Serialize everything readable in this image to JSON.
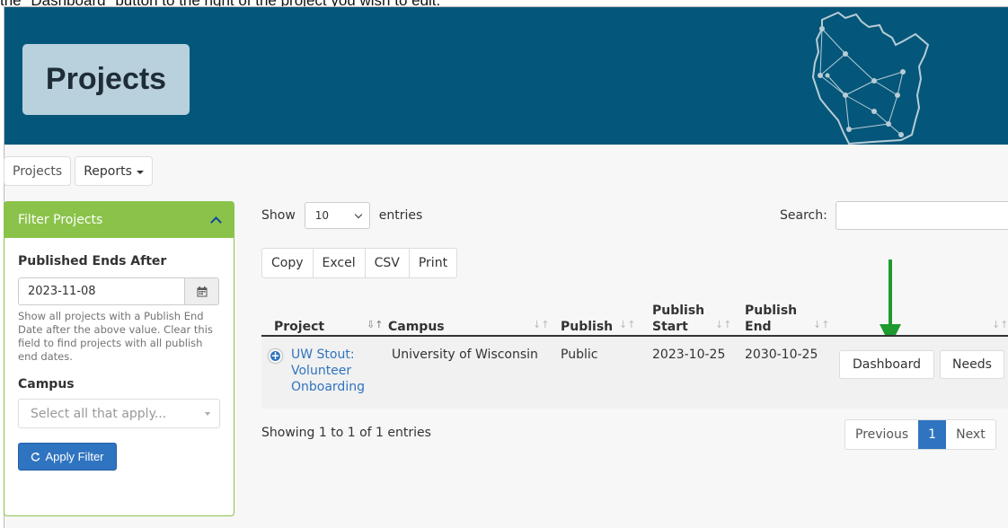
{
  "caption": "the \"Dashboard\" button to the right of the project you wish to edit.",
  "banner": {
    "title": "Projects"
  },
  "nav": {
    "projects_tab": "Projects",
    "reports_tab": "Reports"
  },
  "filter_panel": {
    "heading": "Filter Projects",
    "published_label": "Published Ends After",
    "date_value": "2023-11-08",
    "help_text": "Show all projects with a Publish End Date after the above value. Clear this field to find projects with all publish end dates.",
    "campus_label": "Campus",
    "campus_placeholder": "Select all that apply...",
    "apply_button": "Apply Filter"
  },
  "table_controls": {
    "show_label": "Show",
    "entries_value": "10",
    "entries_label": "entries",
    "search_label": "Search:",
    "export_buttons": [
      "Copy",
      "Excel",
      "CSV",
      "Print"
    ]
  },
  "table": {
    "headers": {
      "project": "Project",
      "campus": "Campus",
      "publish": "Publish",
      "publish_start_1": "Publish",
      "publish_start_2": "Start",
      "publish_end_1": "Publish",
      "publish_end_2": "End"
    },
    "row": {
      "project_line1": "UW Stout:",
      "project_line2": "Volunteer",
      "project_line3": "Onboarding",
      "campus": "University of Wisconsin",
      "publish": "Public",
      "start": "2023-10-25",
      "end": "2030-10-25",
      "dashboard_button": "Dashboard",
      "needs_button": "Needs"
    }
  },
  "footer": {
    "showing": "Showing 1 to 1 of 1 entries",
    "previous": "Previous",
    "page": "1",
    "next": "Next"
  },
  "colors": {
    "banner": "#04577a",
    "panel_green": "#8bc34a",
    "primary_blue": "#2f74c0",
    "arrow_green": "#1e9a2e"
  }
}
